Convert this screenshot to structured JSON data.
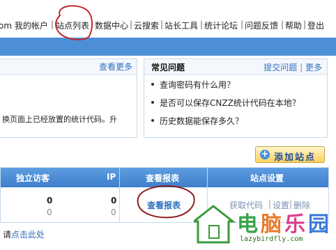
{
  "nav": {
    "items": [
      "om 我的帐户",
      "站点列表",
      "数据中心",
      "云搜索",
      "站长工具",
      "统计论坛",
      "问题反馈",
      "帮助",
      "登出"
    ]
  },
  "announce": {
    "more": "查看更多",
    "text": "换页面上已经放置的统计代码。升"
  },
  "faq": {
    "title": "常见问题",
    "submit": "提交问题",
    "more": "更多",
    "items": [
      "查询密码有什么用？",
      "是否可以保存CNZZ统计代码在本地？",
      "历史数据能保存多久？"
    ]
  },
  "add_site": {
    "label": "添加站点"
  },
  "table": {
    "headers": [
      "独立访客",
      "IP",
      "查看报表",
      "站点设置"
    ],
    "row": {
      "uv_today": "0",
      "uv_yesterday": "0",
      "ip_today": "0",
      "ip_yesterday": "0",
      "report_link": "查看报表",
      "get_code": "获取代码",
      "settings": "设置",
      "delete": "删除"
    }
  },
  "bottom": {
    "prefix": "请",
    "link": "点击此处"
  },
  "watermark": {
    "url": "lazybirdfly.com"
  },
  "colors": {
    "bluebar": "#4d8fd6",
    "link": "#2f6fbf",
    "annotation": "#c0282a"
  }
}
